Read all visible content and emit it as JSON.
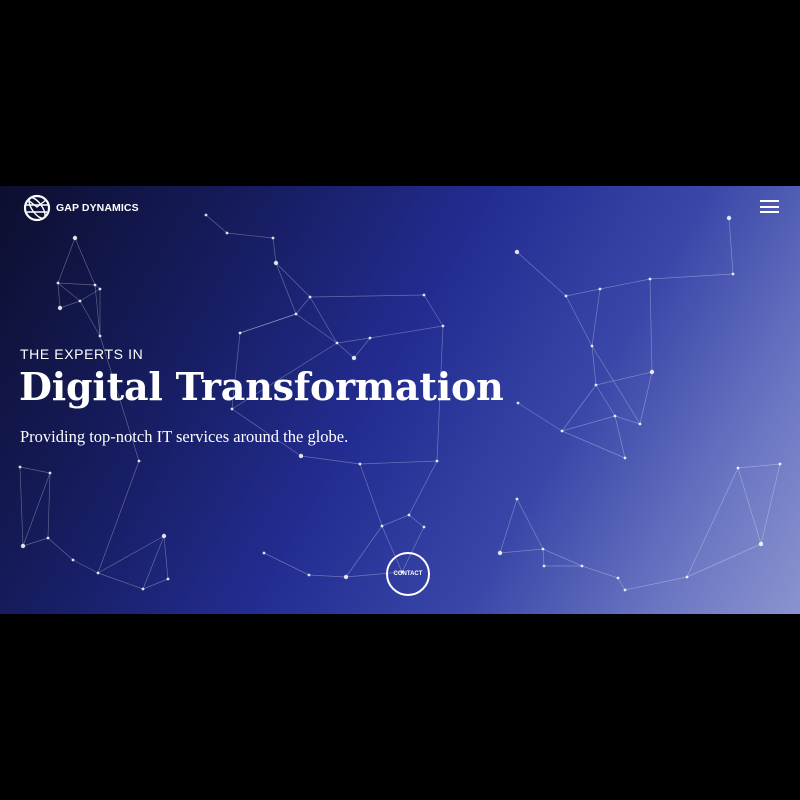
{
  "header": {
    "brand_name": "GAP DYNAMICS",
    "menu_icon": "hamburger-menu-icon",
    "logo_icon": "globe-logo-icon"
  },
  "hero": {
    "eyebrow": "THE EXPERTS IN",
    "headline": "Digital Transformation",
    "tagline": "Providing top-notch IT services around the globe.",
    "contact_label": "CONTACT"
  },
  "colors": {
    "gradient_dark": "#0c0f2e",
    "gradient_mid": "#232d92",
    "gradient_light": "#8b93cf",
    "text": "#ffffff",
    "frame": "#000000"
  }
}
